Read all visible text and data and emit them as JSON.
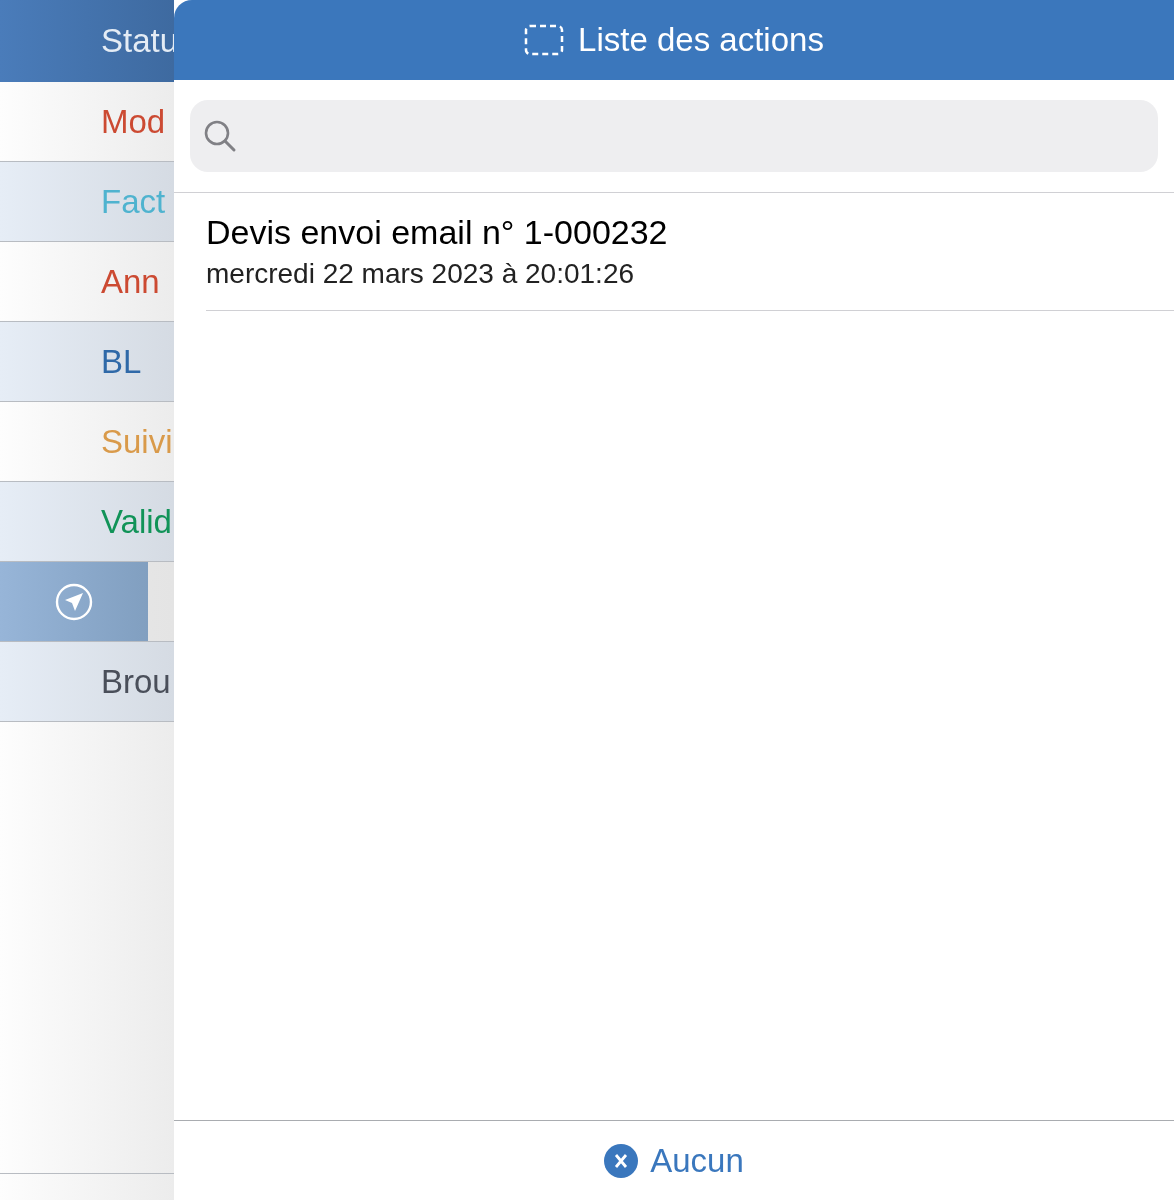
{
  "background_list": {
    "header": "Statu",
    "items": [
      {
        "kind": "text",
        "label": "Mod",
        "color": "#cc4a32"
      },
      {
        "kind": "text",
        "label": "Fact",
        "color": "#4fb3cf"
      },
      {
        "kind": "text",
        "label": "Ann",
        "color": "#cc4a32"
      },
      {
        "kind": "text",
        "label": "BL",
        "color": "#2f69a8"
      },
      {
        "kind": "text",
        "label": "Suivi",
        "color": "#d99a4a"
      },
      {
        "kind": "text",
        "label": "Valid",
        "color": "#119358"
      },
      {
        "kind": "icon",
        "selected": true
      },
      {
        "kind": "text",
        "label": "Brou",
        "color": "#4a4f5a"
      }
    ]
  },
  "popover": {
    "title": "Liste des actions",
    "search": {
      "kind": "field"
    },
    "actions": [
      {
        "title": "Devis envoi email n° 1-000232",
        "date": "mercredi 22 mars 2023 à 20:01:26"
      }
    ],
    "footer_button": "Aucun"
  }
}
